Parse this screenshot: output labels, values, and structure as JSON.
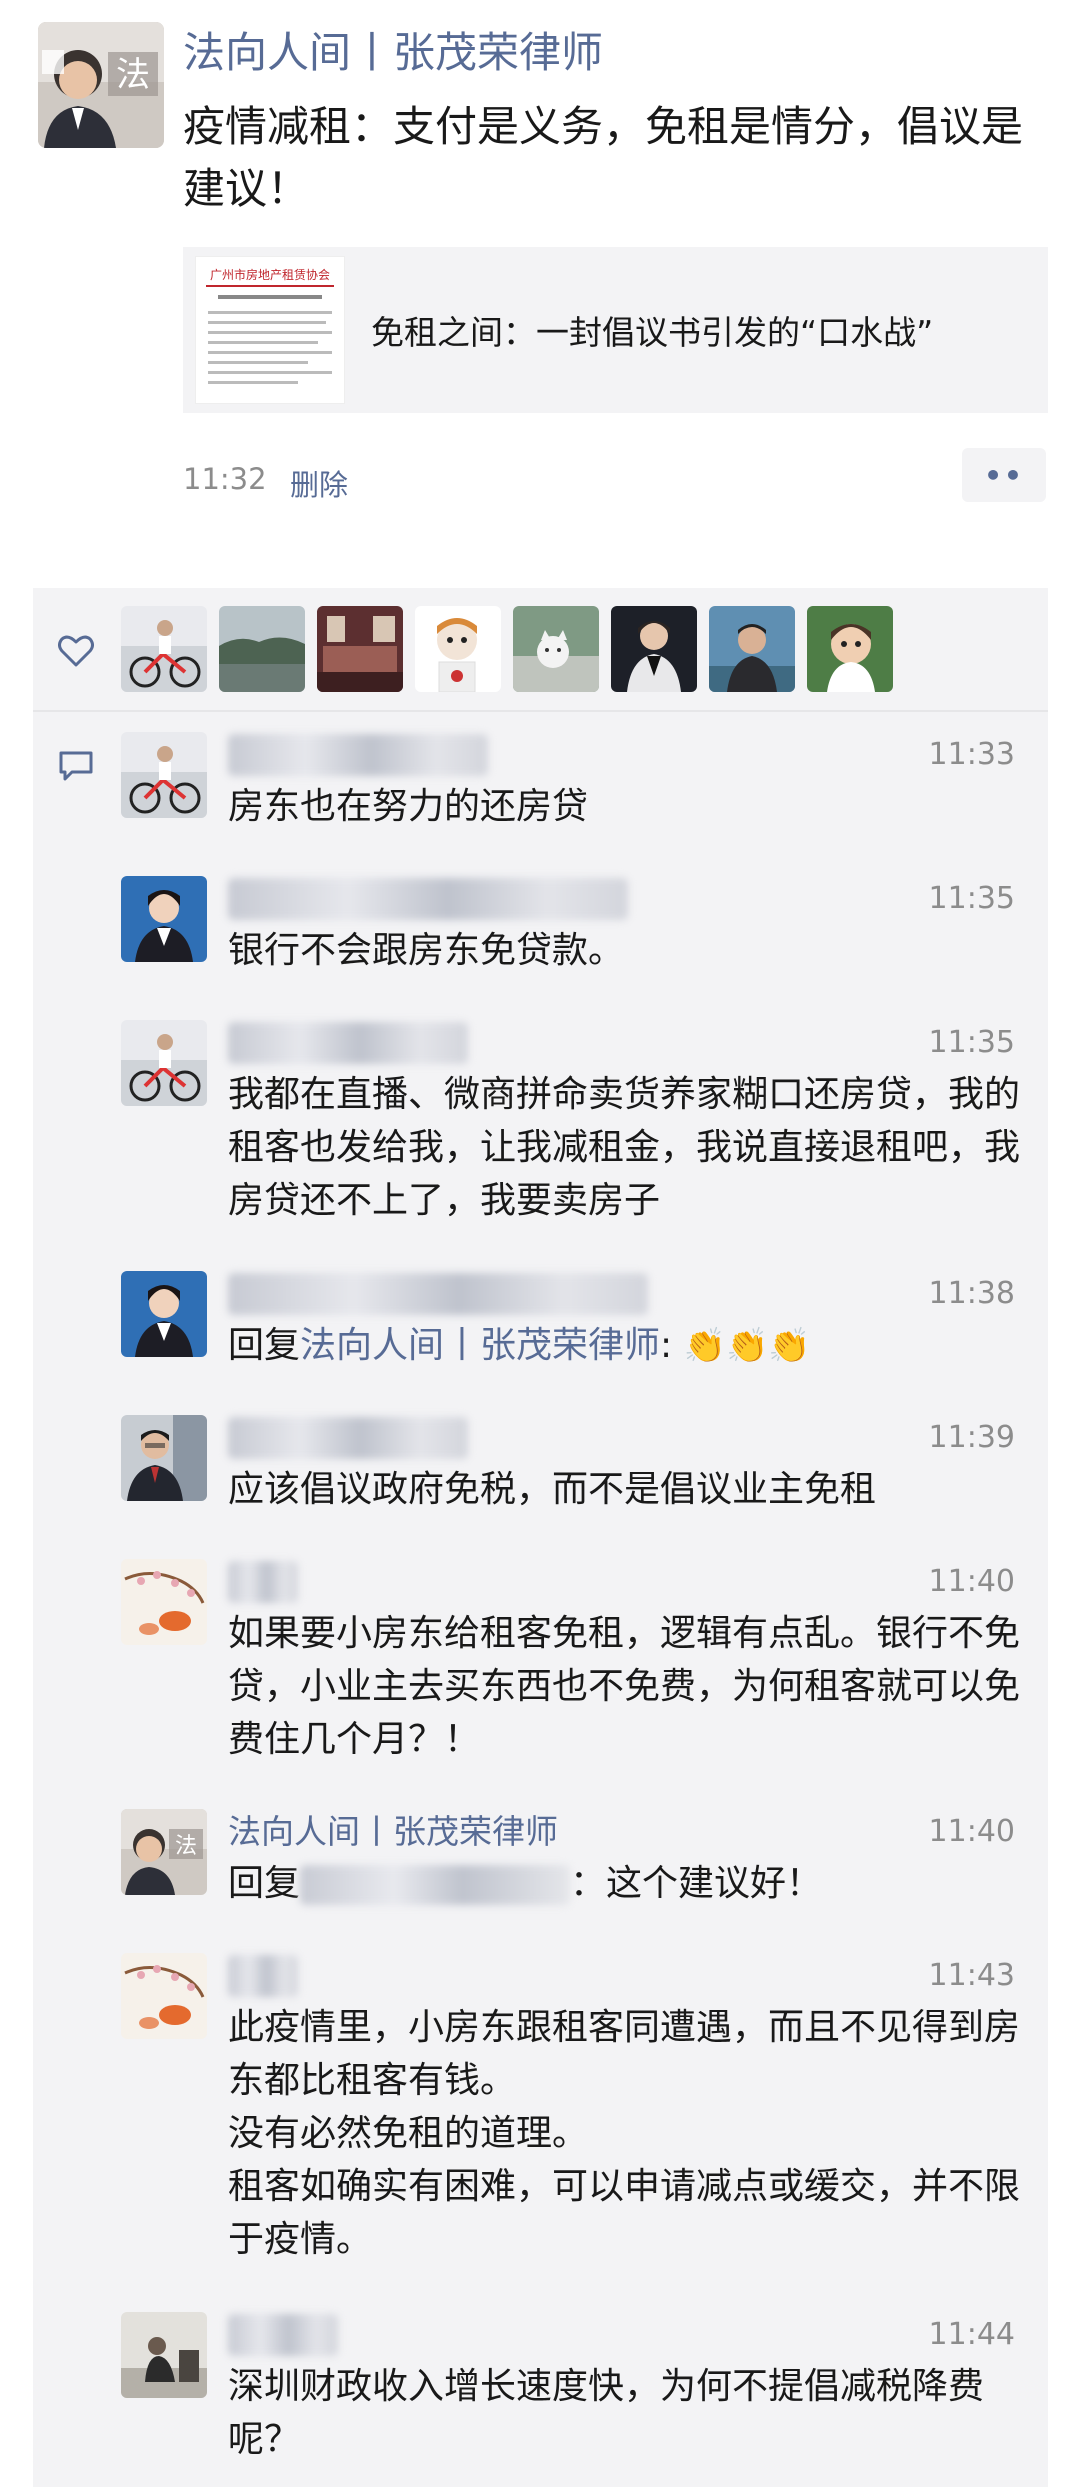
{
  "post": {
    "author": "法向人间丨张茂荣律师",
    "avatar_text": "法",
    "text": "疫情减租：支付是义务，免租是情分，倡议是建议！",
    "link_card": {
      "thumb_title": "广州市房地产租赁协会",
      "title": "免租之间：一封倡议书引发的“口水战”"
    },
    "time": "11:32",
    "delete_label": "删除",
    "more_label": "••"
  },
  "likes": {
    "icon": "heart-outline-icon",
    "count_avatars": 8
  },
  "comments_icon": "comment-bubble-icon",
  "comments": [
    {
      "time": "11:33",
      "text": "房东也在努力的还房贷"
    },
    {
      "time": "11:35",
      "text": "银行不会跟房东免贷款。"
    },
    {
      "time": "11:35",
      "text": "我都在直播、微商拼命卖货养家糊口还房贷，我的租客也发给我，让我减租金，我说直接退租吧，我房贷还不上了，我要卖房子"
    },
    {
      "time": "11:38",
      "reply_prefix": "回复",
      "reply_to": "法向人间丨张茂荣律师",
      "reply_sep": ":",
      "claps": "👏👏👏"
    },
    {
      "time": "11:39",
      "text": "应该倡议政府免税，而不是倡议业主免租"
    },
    {
      "time": "11:40",
      "text": "如果要小房东给租客免租，逻辑有点乱。银行不免贷，小业主去买东西也不免费，为何租客就可以免费住几个月？！"
    },
    {
      "time": "11:40",
      "name": "法向人间丨张茂荣律师",
      "reply_prefix": "回复",
      "reply_suffix": "：这个建议好！"
    },
    {
      "time": "11:43",
      "lines": [
        "此疫情里，小房东跟租客同遭遇，而且不见得到房东都比租客有钱。",
        "没有必然免租的道理。",
        "租客如确实有困难，可以申请减点或缓交，并不限于疫情。"
      ]
    },
    {
      "time": "11:44",
      "text": "深圳财政收入增长速度快，为何不提倡减税降费呢？"
    }
  ]
}
